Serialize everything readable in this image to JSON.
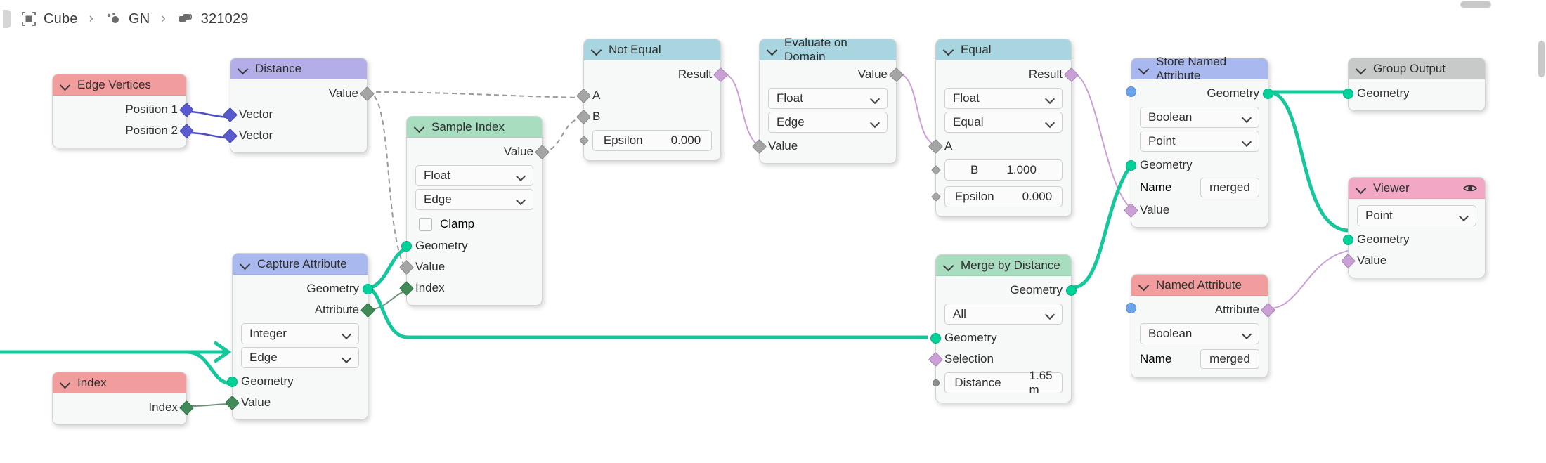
{
  "breadcrumb": {
    "items": [
      {
        "icon": "object-icon",
        "label": "Cube"
      },
      {
        "icon": "geometry-nodes-icon",
        "label": "GN"
      },
      {
        "icon": "node-tree-icon",
        "label": "321029"
      }
    ],
    "separator": "›"
  },
  "editor": {
    "name": "geometry-node-editor"
  },
  "nodes": {
    "edge_vertices": {
      "title": "Edge Vertices",
      "outputs": [
        "Position 1",
        "Position 2"
      ]
    },
    "distance": {
      "title": "Distance",
      "outputs": [
        "Value"
      ],
      "inputs": [
        "Vector",
        "Vector"
      ]
    },
    "sample_index": {
      "title": "Sample Index",
      "outputs": [
        "Value"
      ],
      "data_type": "Float",
      "domain": "Edge",
      "clamp_label": "Clamp",
      "clamp_checked": false,
      "inputs": [
        "Geometry",
        "Value",
        "Index"
      ]
    },
    "not_equal": {
      "title": "Not Equal",
      "outputs": [
        "Result"
      ],
      "inputs": [
        "A",
        "B"
      ],
      "epsilon_label": "Epsilon",
      "epsilon_value": "0.000"
    },
    "evaluate_on_domain": {
      "title": "Evaluate on Domain",
      "outputs": [
        "Value"
      ],
      "data_type": "Float",
      "domain": "Edge",
      "inputs": [
        "Value"
      ]
    },
    "equal": {
      "title": "Equal",
      "outputs": [
        "Result"
      ],
      "data_type": "Float",
      "operation": "Equal",
      "inputs": [
        "A"
      ],
      "b_label": "B",
      "b_value": "1.000",
      "epsilon_label": "Epsilon",
      "epsilon_value": "0.000"
    },
    "store_named_attribute": {
      "title": "Store Named Attribute",
      "outputs": [
        "Geometry"
      ],
      "data_type": "Boolean",
      "domain": "Point",
      "inputs": [
        "Geometry",
        "Name",
        "Value"
      ],
      "name_label": "Name",
      "name_value": "merged"
    },
    "group_output": {
      "title": "Group Output",
      "inputs": [
        "Geometry"
      ]
    },
    "viewer": {
      "title": "Viewer",
      "icon": "eye-icon",
      "domain": "Point",
      "inputs": [
        "Geometry",
        "Value"
      ]
    },
    "capture_attribute": {
      "title": "Capture Attribute",
      "outputs": [
        "Geometry",
        "Attribute"
      ],
      "data_type": "Integer",
      "domain": "Edge",
      "inputs": [
        "Geometry",
        "Value"
      ]
    },
    "index": {
      "title": "Index",
      "outputs": [
        "Index"
      ]
    },
    "merge_by_distance": {
      "title": "Merge by Distance",
      "outputs": [
        "Geometry"
      ],
      "mode": "All",
      "inputs": [
        "Geometry",
        "Selection"
      ],
      "distance_label": "Distance",
      "distance_value": "1.65 m"
    },
    "named_attribute": {
      "title": "Named Attribute",
      "outputs": [
        "Attribute"
      ],
      "data_type": "Boolean",
      "inputs": [
        "Name"
      ],
      "name_label": "Name",
      "name_value": "merged"
    }
  },
  "colors": {
    "header_red": "#f29d9d",
    "header_purple": "#b4aee8",
    "header_green": "#a8ddc0",
    "header_cyan": "#a8d5e0",
    "header_blue": "#a9b8ef",
    "header_grey": "#c8c9c9",
    "header_pink": "#f2a8c4",
    "socket_vector": "#5a5ad0",
    "socket_float": "#a5a5a5",
    "socket_geometry": "#00d39a",
    "socket_integer": "#3f8a56",
    "socket_boolean": "#cba0d6",
    "socket_string": "#6ba4ed",
    "wire_geometry": "#15c79a",
    "wire_boolean": "#cba0d6",
    "wire_vector": "#4f4fc4",
    "wire_float": "#9a9a9a",
    "node_body": "#f7f8f8"
  }
}
